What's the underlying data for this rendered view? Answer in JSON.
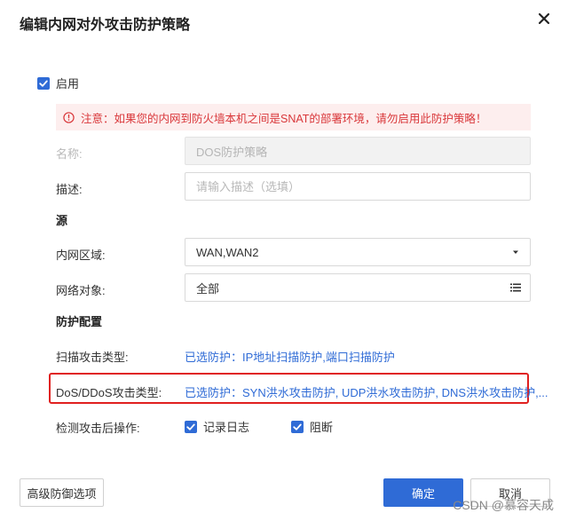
{
  "dialog": {
    "title": "编辑内网对外攻击防护策略"
  },
  "enable": {
    "label": "启用",
    "checked": true
  },
  "notice": {
    "text": "注意：如果您的内网到防火墙本机之间是SNAT的部署环境，请勿启用此防护策略！"
  },
  "form": {
    "name": {
      "label": "名称:",
      "value": "DOS防护策略"
    },
    "description": {
      "label": "描述:",
      "placeholder": "请输入描述（选填）",
      "value": ""
    },
    "source_section": "源",
    "internal_zone": {
      "label": "内网区域:",
      "value": "WAN,WAN2"
    },
    "network_object": {
      "label": "网络对象:",
      "value": "全部"
    },
    "protection_section": "防护配置",
    "scan_attack": {
      "label": "扫描攻击类型:",
      "value": "已选防护：IP地址扫描防护,端口扫描防护"
    },
    "ddos_attack": {
      "label": "DoS/DDoS攻击类型:",
      "value": "已选防护：SYN洪水攻击防护, UDP洪水攻击防护, DNS洪水攻击防护,..."
    },
    "after_detect": {
      "label": "检测攻击后操作:",
      "options": [
        {
          "label": "记录日志",
          "checked": true
        },
        {
          "label": "阻断",
          "checked": true
        }
      ]
    }
  },
  "footer": {
    "advanced_label": "高级防御选项",
    "confirm_label": "确定",
    "cancel_label": "取消"
  },
  "watermark": "CSDN @慕容天成",
  "colors": {
    "primary": "#2f6bd6",
    "warning_text": "#d9373a",
    "warning_bg": "#fdeeee",
    "highlight": "#e0201f"
  }
}
